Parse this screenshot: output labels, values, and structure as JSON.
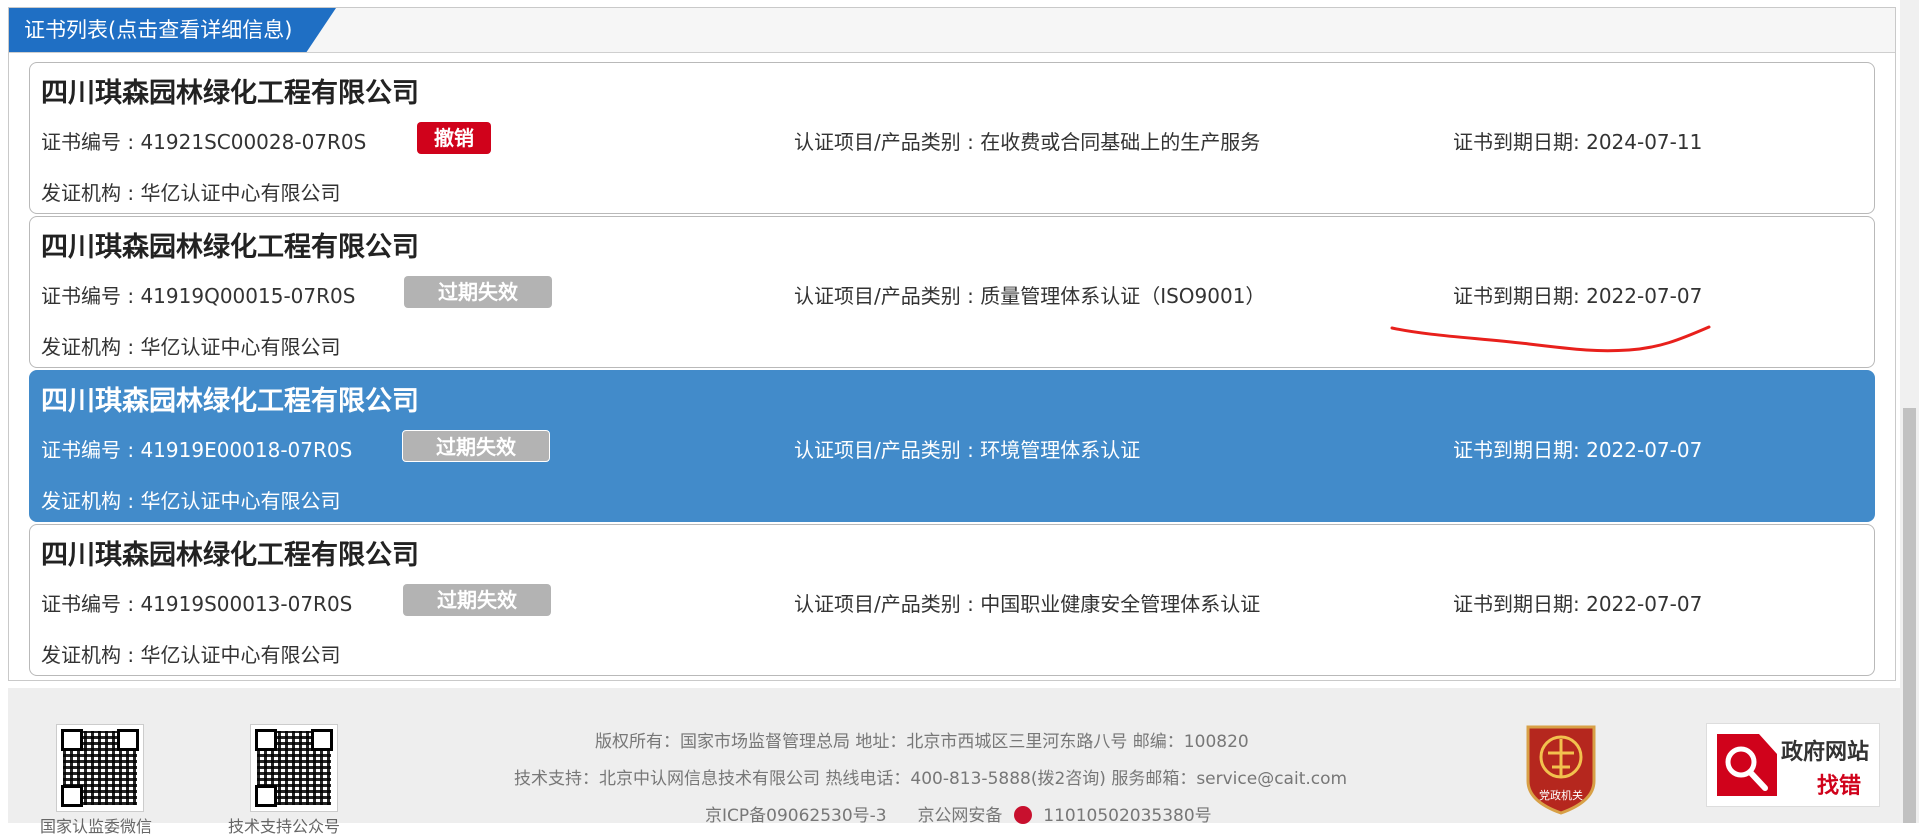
{
  "panel": {
    "title": "证书列表(点击查看详细信息)"
  },
  "certificates": [
    {
      "company": "四川琪森园林绿化工程有限公司",
      "cert_no": "证书编号 : 41921SC00028-07R0S",
      "status": "撤销",
      "category": "认证项目/产品类别 : 在收费或合同基础上的生产服务",
      "expiry": "证书到期日期: 2024-07-11",
      "issuer": "发证机构 : 华亿认证中心有限公司"
    },
    {
      "company": "四川琪森园林绿化工程有限公司",
      "cert_no": "证书编号 : 41919Q00015-07R0S",
      "status": "过期失效",
      "category": "认证项目/产品类别 : 质量管理体系认证（ISO9001）",
      "expiry": "证书到期日期: 2022-07-07",
      "issuer": "发证机构 : 华亿认证中心有限公司"
    },
    {
      "company": "四川琪森园林绿化工程有限公司",
      "cert_no": "证书编号 : 41919E00018-07R0S",
      "status": "过期失效",
      "category": "认证项目/产品类别 : 环境管理体系认证",
      "expiry": "证书到期日期: 2022-07-07",
      "issuer": "发证机构 : 华亿认证中心有限公司"
    },
    {
      "company": "四川琪森园林绿化工程有限公司",
      "cert_no": "证书编号 : 41919S00013-07R0S",
      "status": "过期失效",
      "category": "认证项目/产品类别 : 中国职业健康安全管理体系认证",
      "expiry": "证书到期日期: 2022-07-07",
      "issuer": "发证机构 : 华亿认证中心有限公司"
    }
  ],
  "footer": {
    "qr1_label": "国家认监委微信",
    "qr2_label": "技术支持公众号",
    "line1": "版权所有：国家市场监督管理总局    地址：北京市西城区三里河东路八号    邮编：100820",
    "line2": "技术支持：北京中认网信息技术有限公司    热线电话：400-813-5888(拨2咨询)    服务邮箱：service@cait.com",
    "line3_icp": "京ICP备09062530号-3",
    "line3_police": "京公网安备",
    "line3_police_no": "11010502035380号",
    "emblem_text": "党政机关",
    "gov_title": "政府网站",
    "gov_sub": "找错"
  },
  "colors": {
    "tab_blue": "#1f6fc4",
    "selected_row": "#428bca",
    "revoked_badge": "#d0021b",
    "expired_badge": "#b3b3b3",
    "annotation_red": "#e8201c"
  }
}
